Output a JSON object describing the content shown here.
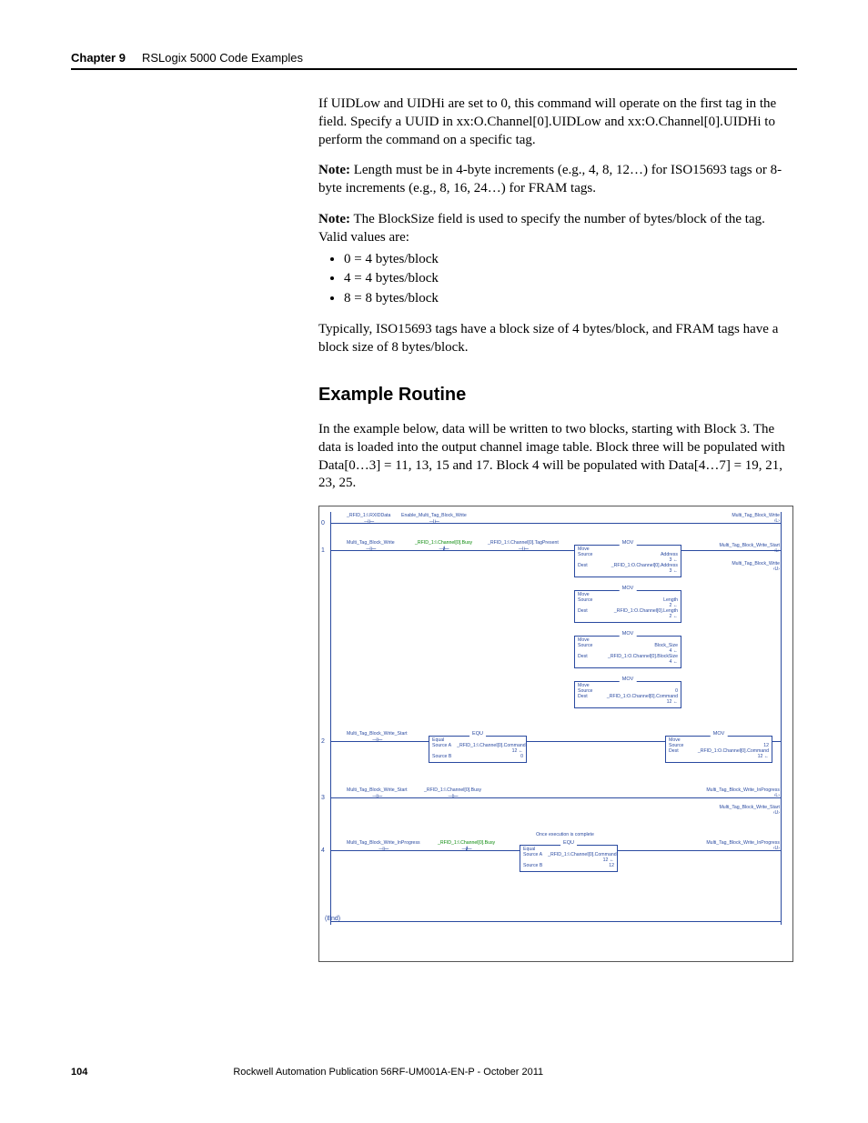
{
  "header": {
    "chapter": "Chapter 9",
    "title": "RSLogix 5000 Code Examples"
  },
  "para1": "If UIDLow and UIDHi are set to 0, this command will operate on the first tag in the field. Specify a UUID in xx:O.Channel[0].UIDLow and xx:O.Channel[0].UIDHi to perform the command on a specific tag.",
  "note1_label": "Note:",
  "note1_text": " Length must be in 4-byte increments (e.g., 4, 8, 12…) for ISO15693 tags or 8-byte increments (e.g., 8, 16, 24…) for FRAM tags.",
  "note2_label": "Note:",
  "note2_text": " The BlockSize field is used to specify the number of bytes/block of the tag. Valid values are:",
  "bullets": [
    "0 = 4 bytes/block",
    "4 = 4 bytes/block",
    "8 = 8 bytes/block"
  ],
  "para2": "Typically, ISO15693 tags have a block size of 4 bytes/block, and FRAM tags have a block size of 8 bytes/block.",
  "h2": "Example Routine",
  "para3": "In the example below, data will be written to two blocks, starting with Block 3. The data is loaded into the output channel image table. Block three will be populated with Data[0…3] = 11, 13, 15 and 17. Block 4 will be populated with Data[4…7] = 19, 21, 23, 25.",
  "ladder": {
    "rung0": {
      "contact1": "_RFID_1:I.RXIDData",
      "contact2": "Enable_Multi_Tag_Block_Write",
      "coil": "Multi_Tag_Block_Write"
    },
    "rung1": {
      "contact1": "Multi_Tag_Block_Write",
      "contact2": "_RFID_1:I.Channel[0].Busy",
      "contact3": "_RFID_1:I.Channel[0].TagPresent",
      "mov1": {
        "title": "MOV",
        "r1a": "Move",
        "r2a": "Source",
        "r2b": "Address",
        "r3b": "3 ←",
        "r4a": "Dest",
        "r4b": "_RFID_1:O.Channel[0].Address",
        "r5b": "3 ←"
      },
      "mov2": {
        "title": "MOV",
        "r1a": "Move",
        "r2a": "Source",
        "r2b": "Length",
        "r3b": "2 ←",
        "r4a": "Dest",
        "r4b": "_RFID_1:O.Channel[0].Length",
        "r5b": "2 ←"
      },
      "mov3": {
        "title": "MOV",
        "r1a": "Move",
        "r2a": "Source",
        "r2b": "Block_Size",
        "r3b": "4 ←",
        "r4a": "Dest",
        "r4b": "_RFID_1:O.Channel[0].BlockSize",
        "r5b": "4 ←"
      },
      "mov4": {
        "title": "MOV",
        "r1a": "Move",
        "r2a": "Source",
        "r2b": "0",
        "r4a": "Dest",
        "r4b": "_RFID_1:O.Channel[0].Command",
        "r5b": "12 ←"
      },
      "coil1": "Multi_Tag_Block_Write_Start",
      "coil2": "Multi_Tag_Block_Write"
    },
    "rung2": {
      "contact1": "Multi_Tag_Block_Write_Start",
      "equ": {
        "title": "EQU",
        "r1a": "Equal",
        "r2a": "Source A",
        "r2b": "_RFID_1:I.Channel[0].Command",
        "r3b": "12 ←",
        "r4a": "Source B",
        "r4b": "0"
      },
      "mov": {
        "title": "MOV",
        "r1a": "Move",
        "r2a": "Source",
        "r2b": "12",
        "r4a": "Dest",
        "r4b": "_RFID_1:O.Channel[0].Command",
        "r5b": "12 ←"
      }
    },
    "rung3": {
      "contact1": "Multi_Tag_Block_Write_Start",
      "contact2": "_RFID_1:I.Channel[0].Busy",
      "coil1": "Multi_Tag_Block_Write_InProgress",
      "coil2": "Multi_Tag_Block_Write_Start"
    },
    "rung4": {
      "comment": "Once execution is complete",
      "contact1": "Multi_Tag_Block_Write_InProgress",
      "contact2": "_RFID_1:I.Channel[0].Busy",
      "equ": {
        "title": "EQU",
        "r1a": "Equal",
        "r2a": "Source A",
        "r2b": "_RFID_1:I.Channel[0].Command",
        "r3b": "12 ←",
        "r4a": "Source B",
        "r4b": "12"
      },
      "coil": "Multi_Tag_Block_Write_InProgress"
    },
    "end": "(End)"
  },
  "footer": {
    "page": "104",
    "pub": "Rockwell Automation Publication 56RF-UM001A-EN-P - October 2011"
  }
}
